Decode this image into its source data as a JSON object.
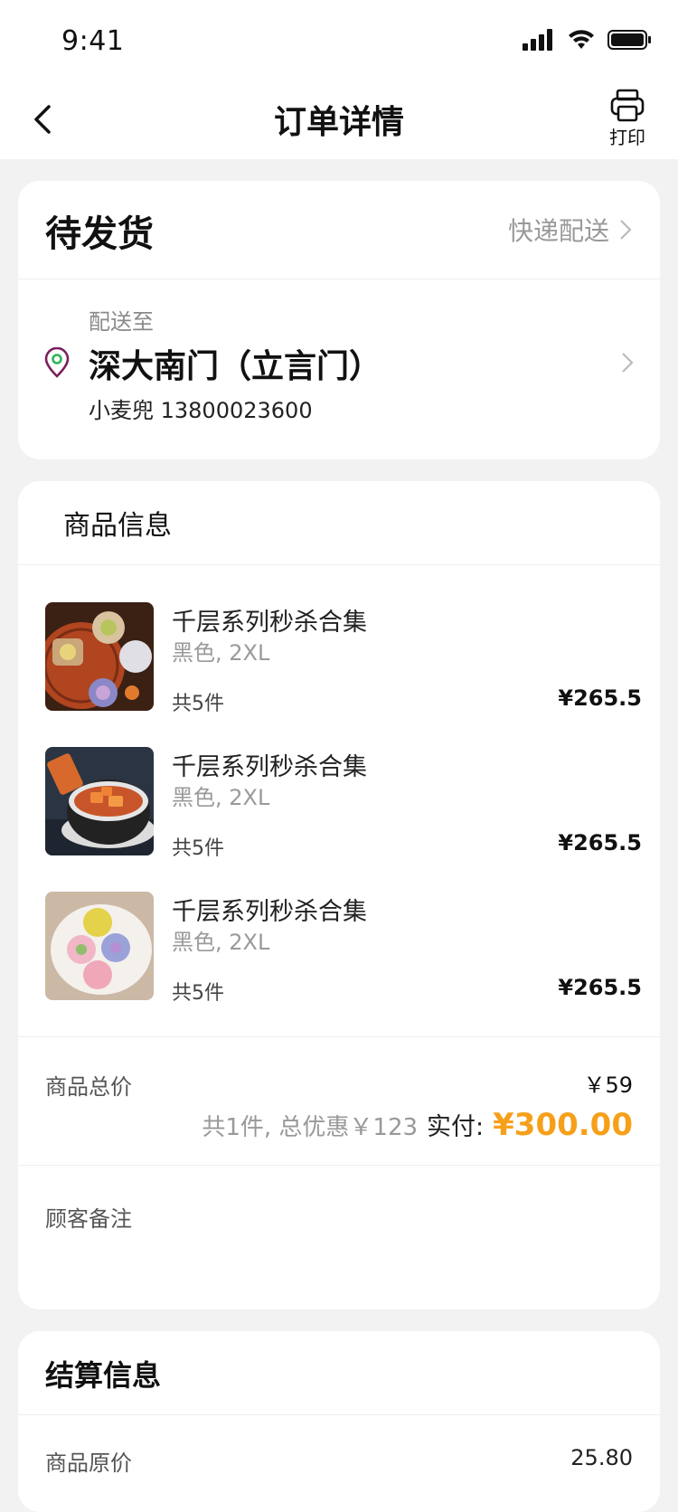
{
  "status_bar": {
    "time": "9:41"
  },
  "nav": {
    "title": "订单详情",
    "print_label": "打印"
  },
  "order": {
    "status": "待发货",
    "delivery_method": "快递配送",
    "address_label": "配送至",
    "address_name": "深大南门（立言门）",
    "contact": "小麦兜 13800023600"
  },
  "products": {
    "title": "商品信息",
    "items": [
      {
        "name": "千层系列秒杀合集",
        "spec": "黑色, 2XL",
        "qty": "共5件",
        "price": "¥265.5",
        "thumb": "mooncake-platter-image"
      },
      {
        "name": "千层系列秒杀合集",
        "spec": "黑色, 2XL",
        "qty": "共5件",
        "price": "¥265.5",
        "thumb": "papaya-soup-image"
      },
      {
        "name": "千层系列秒杀合集",
        "spec": "黑色, 2XL",
        "qty": "共5件",
        "price": "¥265.5",
        "thumb": "snowskin-mooncake-image"
      }
    ]
  },
  "summary": {
    "total_label": "商品总价",
    "total_value": "￥59",
    "count_discount": "共1件, 总优惠￥123",
    "paid_label": "实付:",
    "paid_value": "¥300.00"
  },
  "remark": {
    "label": "顾客备注"
  },
  "settlement": {
    "title": "结算信息",
    "original_price_label": "商品原价",
    "original_price_value": "25.80"
  },
  "colors": {
    "accent": "#f6a01a",
    "pin": "#7a1f5c",
    "pin_inner": "#2fb35a"
  }
}
